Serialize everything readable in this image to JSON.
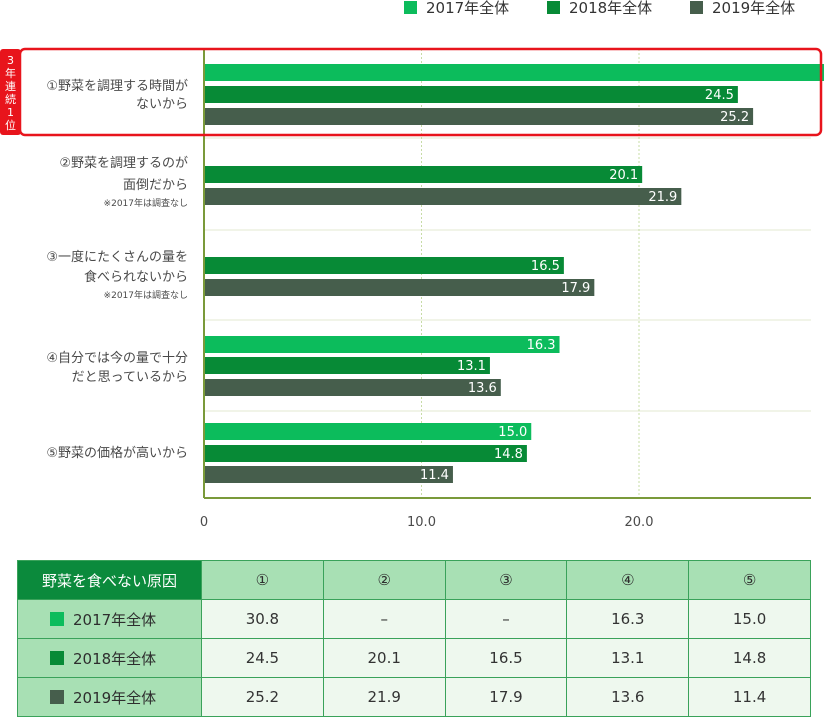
{
  "chart_data": {
    "type": "bar",
    "orientation": "horizontal",
    "legend": [
      {
        "name": "2017年全体",
        "color": "#0cbc5c"
      },
      {
        "name": "2018年全体",
        "color": "#078a36"
      },
      {
        "name": "2019年全体",
        "color": "#465e4c"
      }
    ],
    "legend_position": "top-right",
    "categories": [
      {
        "label_lines": [
          "①野菜を調理する時間が",
          "ないから"
        ],
        "note": ""
      },
      {
        "label_lines": [
          "②野菜を調理するのが",
          "面倒だから"
        ],
        "note": "※2017年は調査なし"
      },
      {
        "label_lines": [
          "③一度にたくさんの量を",
          "食べられないから"
        ],
        "note": "※2017年は調査なし"
      },
      {
        "label_lines": [
          "④自分では今の量で十分",
          "だと思っているから"
        ],
        "note": ""
      },
      {
        "label_lines": [
          "⑤野菜の価格が高いから"
        ],
        "note": ""
      }
    ],
    "series": [
      {
        "name": "2017年全体",
        "values": [
          30.8,
          null,
          null,
          16.3,
          15.0
        ],
        "labels": [
          "30.8",
          "",
          "",
          "16.3",
          "15.0"
        ]
      },
      {
        "name": "2018年全体",
        "values": [
          24.5,
          20.1,
          16.5,
          13.1,
          14.8
        ],
        "labels": [
          "24.5",
          "20.1",
          "16.5",
          "13.1",
          "14.8"
        ]
      },
      {
        "name": "2019年全体",
        "values": [
          25.2,
          21.9,
          17.9,
          13.6,
          11.4
        ],
        "labels": [
          "25.2",
          "21.9",
          "17.9",
          "13.6",
          "11.4"
        ]
      }
    ],
    "x_ticks": [
      "0",
      "10.0",
      "20.0"
    ],
    "x_tick_values": [
      0,
      10,
      20
    ],
    "xlim": [
      0,
      28
    ],
    "grid": true,
    "highlight": {
      "badge": [
        "3",
        "年",
        "連",
        "続",
        "1",
        "位"
      ],
      "category_index": 0
    }
  },
  "table": {
    "header_label": "野菜を食べない原因",
    "columns": [
      "①",
      "②",
      "③",
      "④",
      "⑤"
    ],
    "rows": [
      {
        "label": "2017年全体",
        "color": "#0cbc5c",
        "cells": [
          "30.8",
          "–",
          "–",
          "16.3",
          "15.0"
        ]
      },
      {
        "label": "2018年全体",
        "color": "#078a36",
        "cells": [
          "24.5",
          "20.1",
          "16.5",
          "13.1",
          "14.8"
        ]
      },
      {
        "label": "2019年全体",
        "color": "#465e4c",
        "cells": [
          "25.2",
          "21.9",
          "17.9",
          "13.6",
          "11.4"
        ]
      }
    ]
  }
}
